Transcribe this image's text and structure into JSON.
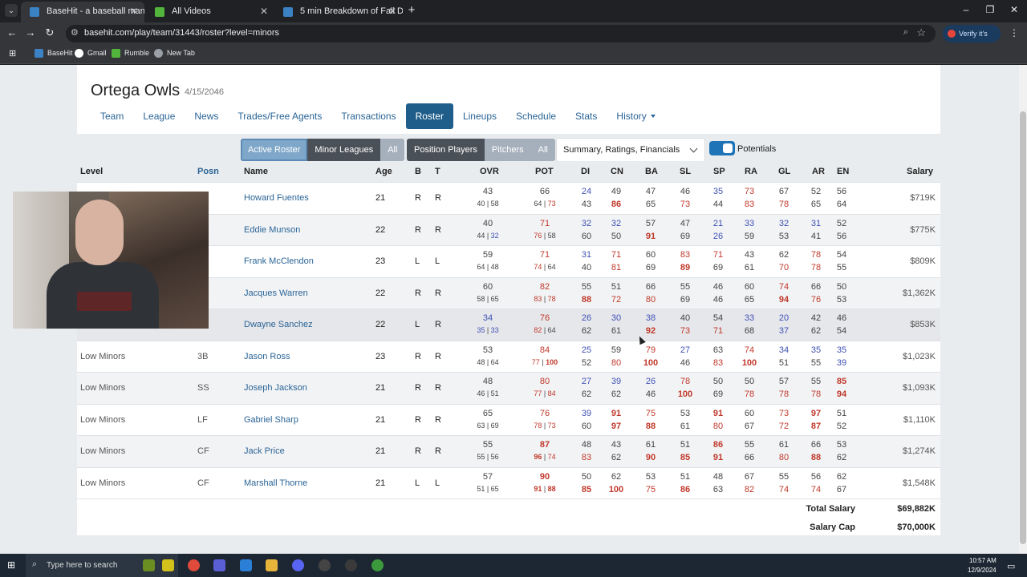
{
  "browser": {
    "tabs": [
      {
        "title": "BaseHit - a baseball manageme",
        "active": true
      },
      {
        "title": "All Videos",
        "active": false
      },
      {
        "title": "5 min Breakdown of Fall Divisio",
        "active": false
      }
    ],
    "url": "basehit.com/play/team/31443/roster?level=minors",
    "verify_label": "Verify it's you",
    "bookmarks": [
      "BaseHit",
      "Gmail",
      "Rumble",
      "New Tab"
    ]
  },
  "team": {
    "name": "Ortega Owls",
    "date": "4/15/2046"
  },
  "nav": {
    "tabs": [
      "Team",
      "League",
      "News",
      "Trades/Free Agents",
      "Transactions",
      "Roster",
      "Lineups",
      "Schedule",
      "Stats",
      "History"
    ],
    "active": "Roster"
  },
  "filters": {
    "roster_group": [
      "Active Roster",
      "Minor Leagues",
      "All"
    ],
    "player_group": [
      "Position Players",
      "Pitchers",
      "All"
    ],
    "view_select": "Summary, Ratings, Financials",
    "potentials_label": "Potentials"
  },
  "table": {
    "headers": [
      "Level",
      "Posn",
      "Name",
      "Age",
      "B",
      "T",
      "OVR",
      "POT",
      "DI",
      "CN",
      "BA",
      "SL",
      "SP",
      "RA",
      "GL",
      "AR",
      "EN",
      "Salary"
    ],
    "rows": [
      {
        "level": "",
        "pos": "",
        "name": "Howard Fuentes",
        "age": "21",
        "b": "R",
        "t": "R",
        "ovr": "43",
        "ovr_sub": [
          "40",
          "58"
        ],
        "pot": "66",
        "pot_sub": [
          "64",
          "73"
        ],
        "ratings": [
          [
            "24",
            "43"
          ],
          [
            "49",
            "86"
          ],
          [
            "47",
            "65"
          ],
          [
            "46",
            "73"
          ],
          [
            "35",
            "44"
          ],
          [
            "73",
            "83"
          ],
          [
            "67",
            "78"
          ],
          [
            "52",
            "65"
          ],
          [
            "56",
            "64"
          ]
        ],
        "salary": "$719K"
      },
      {
        "level": "",
        "pos": "",
        "name": "Eddie Munson",
        "age": "22",
        "b": "R",
        "t": "R",
        "ovr": "40",
        "ovr_sub": [
          "44",
          "32"
        ],
        "pot": "71",
        "pot_sub": [
          "76",
          "58"
        ],
        "ratings": [
          [
            "32",
            "60"
          ],
          [
            "32",
            "50"
          ],
          [
            "57",
            "91"
          ],
          [
            "47",
            "69"
          ],
          [
            "21",
            "26"
          ],
          [
            "33",
            "59"
          ],
          [
            "32",
            "53"
          ],
          [
            "31",
            "41"
          ],
          [
            "52",
            "56"
          ]
        ],
        "salary": "$775K"
      },
      {
        "level": "",
        "pos": "",
        "name": "Frank McClendon",
        "age": "23",
        "b": "L",
        "t": "L",
        "ovr": "59",
        "ovr_sub": [
          "64",
          "48"
        ],
        "pot": "71",
        "pot_sub": [
          "74",
          "64"
        ],
        "ratings": [
          [
            "31",
            "40"
          ],
          [
            "71",
            "81"
          ],
          [
            "60",
            "69"
          ],
          [
            "83",
            "89"
          ],
          [
            "71",
            "69"
          ],
          [
            "43",
            "61"
          ],
          [
            "62",
            "70"
          ],
          [
            "78",
            "78"
          ],
          [
            "54",
            "55"
          ]
        ],
        "salary": "$809K"
      },
      {
        "level": "",
        "pos": "",
        "name": "Jacques Warren",
        "age": "22",
        "b": "R",
        "t": "R",
        "ovr": "60",
        "ovr_sub": [
          "58",
          "65"
        ],
        "pot": "82",
        "pot_sub": [
          "83",
          "78"
        ],
        "ratings": [
          [
            "55",
            "88"
          ],
          [
            "51",
            "72"
          ],
          [
            "66",
            "80"
          ],
          [
            "55",
            "69"
          ],
          [
            "46",
            "46"
          ],
          [
            "60",
            "65"
          ],
          [
            "74",
            "94"
          ],
          [
            "66",
            "76"
          ],
          [
            "50",
            "53"
          ]
        ],
        "salary": "$1,362K"
      },
      {
        "level": "",
        "pos": "",
        "name": "Dwayne Sanchez",
        "age": "22",
        "b": "L",
        "t": "R",
        "ovr": "34",
        "ovr_sub": [
          "35",
          "33"
        ],
        "pot": "76",
        "pot_sub": [
          "82",
          "64"
        ],
        "ratings": [
          [
            "26",
            "62"
          ],
          [
            "30",
            "61"
          ],
          [
            "38",
            "92"
          ],
          [
            "40",
            "73"
          ],
          [
            "54",
            "71"
          ],
          [
            "33",
            "68"
          ],
          [
            "20",
            "37"
          ],
          [
            "42",
            "62"
          ],
          [
            "46",
            "54"
          ]
        ],
        "salary": "$853K"
      },
      {
        "level": "Low Minors",
        "pos": "3B",
        "name": "Jason Ross",
        "age": "23",
        "b": "R",
        "t": "R",
        "ovr": "53",
        "ovr_sub": [
          "48",
          "64"
        ],
        "pot": "84",
        "pot_sub": [
          "77",
          "100"
        ],
        "ratings": [
          [
            "25",
            "52"
          ],
          [
            "59",
            "80"
          ],
          [
            "79",
            "100"
          ],
          [
            "27",
            "46"
          ],
          [
            "63",
            "83"
          ],
          [
            "74",
            "100"
          ],
          [
            "34",
            "51"
          ],
          [
            "35",
            "55"
          ],
          [
            "35",
            "39"
          ]
        ],
        "salary": "$1,023K"
      },
      {
        "level": "Low Minors",
        "pos": "SS",
        "name": "Joseph Jackson",
        "age": "21",
        "b": "R",
        "t": "R",
        "ovr": "48",
        "ovr_sub": [
          "46",
          "51"
        ],
        "pot": "80",
        "pot_sub": [
          "77",
          "84"
        ],
        "ratings": [
          [
            "27",
            "62"
          ],
          [
            "39",
            "62"
          ],
          [
            "26",
            "46"
          ],
          [
            "78",
            "100"
          ],
          [
            "50",
            "69"
          ],
          [
            "50",
            "78"
          ],
          [
            "57",
            "78"
          ],
          [
            "55",
            "78"
          ],
          [
            "85",
            "94"
          ]
        ],
        "salary": "$1,093K"
      },
      {
        "level": "Low Minors",
        "pos": "LF",
        "name": "Gabriel Sharp",
        "age": "21",
        "b": "R",
        "t": "R",
        "ovr": "65",
        "ovr_sub": [
          "63",
          "69"
        ],
        "pot": "76",
        "pot_sub": [
          "78",
          "73"
        ],
        "ratings": [
          [
            "39",
            "60"
          ],
          [
            "91",
            "97"
          ],
          [
            "75",
            "88"
          ],
          [
            "53",
            "61"
          ],
          [
            "91",
            "80"
          ],
          [
            "60",
            "67"
          ],
          [
            "73",
            "72"
          ],
          [
            "97",
            "87"
          ],
          [
            "51",
            "52"
          ]
        ],
        "salary": "$1,110K"
      },
      {
        "level": "Low Minors",
        "pos": "CF",
        "name": "Jack Price",
        "age": "21",
        "b": "R",
        "t": "R",
        "ovr": "55",
        "ovr_sub": [
          "55",
          "56"
        ],
        "pot": "87",
        "pot_sub": [
          "96",
          "74"
        ],
        "ratings": [
          [
            "48",
            "83"
          ],
          [
            "43",
            "62"
          ],
          [
            "61",
            "90"
          ],
          [
            "51",
            "85"
          ],
          [
            "86",
            "91"
          ],
          [
            "55",
            "66"
          ],
          [
            "61",
            "80"
          ],
          [
            "66",
            "88"
          ],
          [
            "53",
            "62"
          ]
        ],
        "salary": "$1,274K"
      },
      {
        "level": "Low Minors",
        "pos": "CF",
        "name": "Marshall Thorne",
        "age": "21",
        "b": "L",
        "t": "L",
        "ovr": "57",
        "ovr_sub": [
          "51",
          "65"
        ],
        "pot": "90",
        "pot_sub": [
          "91",
          "88"
        ],
        "ratings": [
          [
            "50",
            "85"
          ],
          [
            "62",
            "100"
          ],
          [
            "53",
            "75"
          ],
          [
            "51",
            "86"
          ],
          [
            "48",
            "63"
          ],
          [
            "67",
            "82"
          ],
          [
            "55",
            "74"
          ],
          [
            "56",
            "74"
          ],
          [
            "62",
            "67"
          ]
        ],
        "salary": "$1,548K"
      }
    ]
  },
  "totals": {
    "total_salary_label": "Total Salary",
    "total_salary": "$69,882K",
    "salary_cap_label": "Salary Cap",
    "salary_cap": "$70,000K"
  },
  "taskbar": {
    "search_placeholder": "Type here to search",
    "time": "10:57 AM",
    "date": "12/9/2024"
  }
}
